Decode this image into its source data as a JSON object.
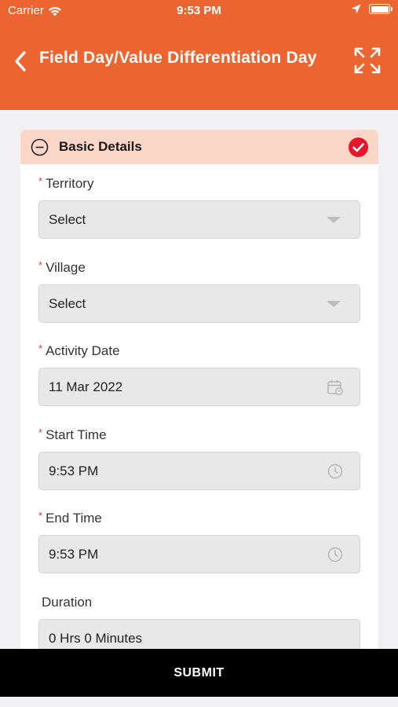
{
  "status_bar": {
    "carrier": "Carrier",
    "time": "9:53 PM",
    "icons": [
      "wifi-icon",
      "location-arrow-icon",
      "battery-icon"
    ]
  },
  "header": {
    "title": "Field Day/Value Differentiation Day",
    "back_icon": "chevron-left-icon",
    "expand_icon": "expand-icon",
    "background": "#ec642f"
  },
  "section": {
    "title": "Basic Details",
    "background": "#fcd6c7",
    "check_color": "#e6172d",
    "fields": [
      {
        "label": "Territory",
        "required": "*",
        "value": "Select",
        "icon": "dropdown-caret-icon"
      },
      {
        "label": "Village",
        "required": "*",
        "value": "Select",
        "icon": "dropdown-caret-icon"
      },
      {
        "label": "Activity Date",
        "required": "*",
        "value": "11 Mar 2022",
        "icon": "calendar-icon"
      },
      {
        "label": "Start Time",
        "required": "*",
        "value": "9:53 PM",
        "icon": "clock-icon"
      },
      {
        "label": "End Time",
        "required": "*",
        "value": "9:53 PM",
        "icon": "clock-icon"
      },
      {
        "label": "Duration",
        "required": "",
        "value": "0 Hrs 0 Minutes"
      }
    ]
  },
  "footer": {
    "submit_label": "SUBMIT"
  }
}
